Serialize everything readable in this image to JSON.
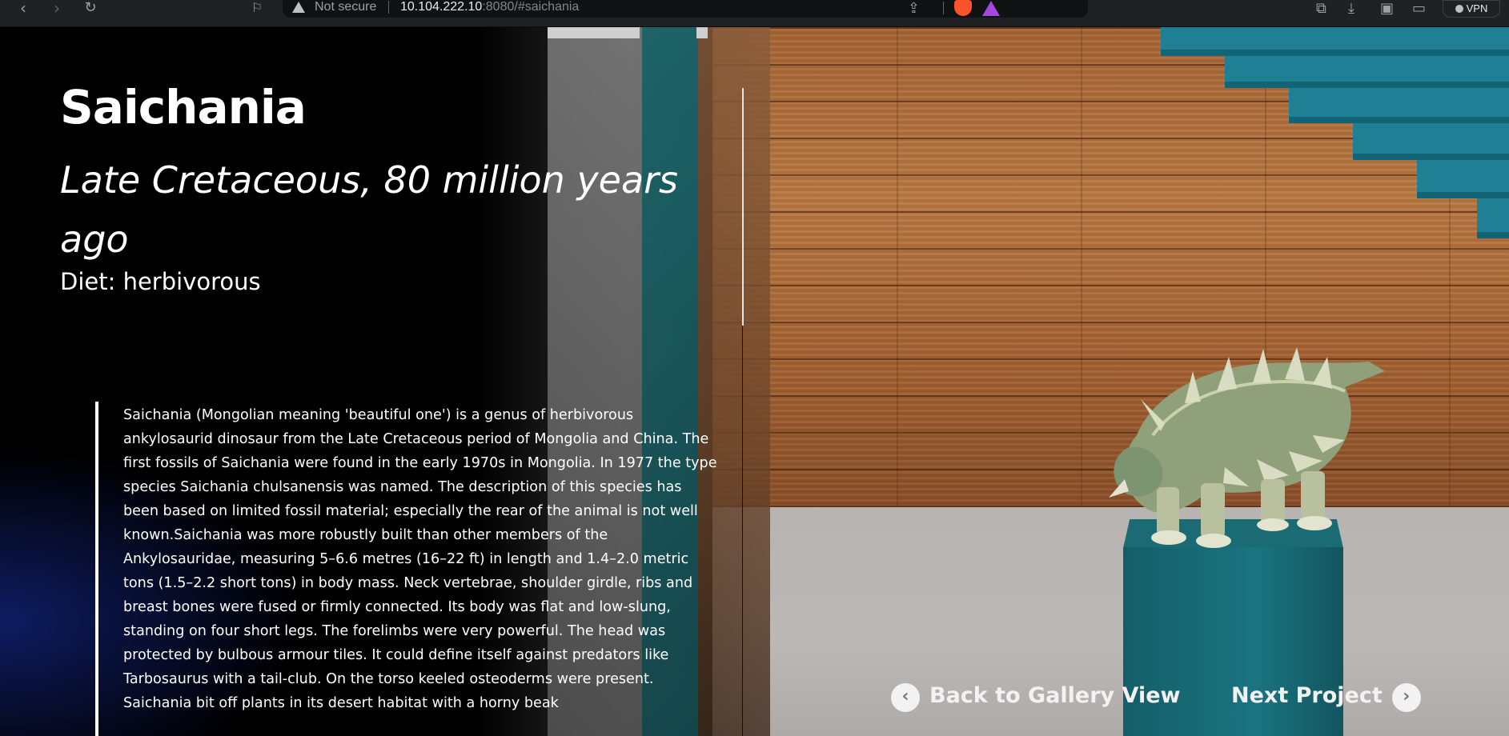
{
  "browser": {
    "security_label": "Not secure",
    "url_host": "10.104.222.10",
    "url_rest": ":8080/#saichania",
    "vpn_label": "VPN"
  },
  "exhibit": {
    "name": "Saichania",
    "period": "Late Cretaceous, 80 million years ago",
    "diet": "Diet: herbivorous",
    "description": "Saichania (Mongolian meaning 'beautiful one') is a genus of herbivorous ankylosaurid dinosaur from the Late Cretaceous period of Mongolia and China. The first fossils of Saichania were found in the early 1970s in Mongolia. In 1977 the type species Saichania chulsanensis was named. The description of this species has been based on limited fossil material; especially the rear of the animal is not well known.Saichania was more robustly built than other members of the Ankylosauridae, measuring 5–6.6 metres (16–22 ft) in length and 1.4–2.0 metric tons (1.5–2.2 short tons) in body mass. Neck vertebrae, shoulder girdle, ribs and breast bones were fused or firmly connected. Its body was flat and low-slung, standing on four short legs. The forelimbs were very powerful. The head was protected by bulbous armour tiles. It could define itself against predators like Tarbosaurus with a tail-club. On the torso keeled osteoderms were present. Saichania bit off plants in its desert habitat with a horny beak"
  },
  "navigation": {
    "back_label": "Back to Gallery View",
    "next_label": "Next Project",
    "back_icon": "chevron-left-icon",
    "next_icon": "chevron-right-icon"
  },
  "colors": {
    "wall": "#b0703d",
    "floor": "#bab6b3",
    "pedestal": "#1a6e78",
    "stairs": "#1f7f95"
  }
}
